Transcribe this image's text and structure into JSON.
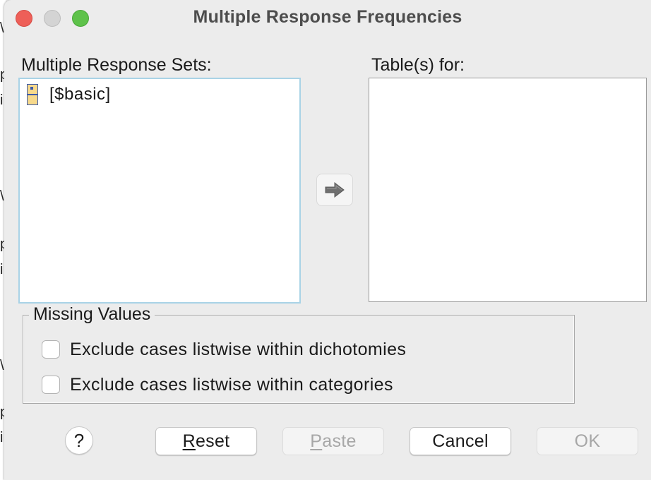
{
  "window": {
    "title": "Multiple Response Frequencies"
  },
  "backdrop": {
    "glyphs": [
      "\\",
      "p",
      "i",
      "\\",
      "p",
      "i",
      "\\",
      "p",
      "i"
    ]
  },
  "source_list": {
    "label": "Multiple Response Sets:",
    "items": [
      {
        "label": "[$basic]",
        "icon": "multiple-response-set-icon"
      }
    ]
  },
  "move_button": {
    "icon": "right-arrow-icon"
  },
  "target_list": {
    "label": "Table(s) for:",
    "items": []
  },
  "missing_values": {
    "legend": "Missing Values",
    "options": [
      {
        "label": "Exclude cases listwise within dichotomies",
        "checked": false
      },
      {
        "label": "Exclude cases listwise within categories",
        "checked": false
      }
    ]
  },
  "buttons": {
    "help": "?",
    "reset": {
      "mnemonic": "R",
      "rest": "eset",
      "enabled": true
    },
    "paste": {
      "mnemonic": "P",
      "rest": "aste",
      "enabled": false
    },
    "cancel": {
      "label": "Cancel",
      "enabled": true
    },
    "ok": {
      "label": "OK",
      "enabled": false
    }
  },
  "colors": {
    "close": "#ee5f58",
    "minimize": "#d4d4d4",
    "zoom": "#5ec24a",
    "focus_ring": "#a9d3e6",
    "set_icon_fill": "#f7d98b",
    "set_icon_stroke": "#3d5aa8"
  }
}
